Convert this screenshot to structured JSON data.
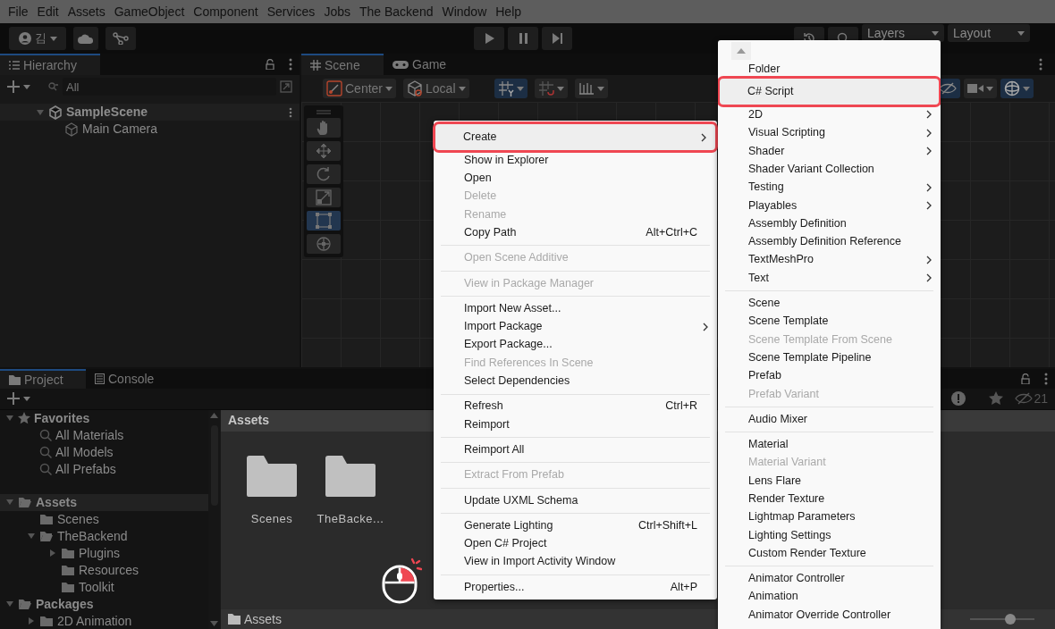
{
  "menu_bar": [
    "File",
    "Edit",
    "Assets",
    "GameObject",
    "Component",
    "Services",
    "Jobs",
    "The Backend",
    "Window",
    "Help"
  ],
  "toolbar": {
    "account": "김",
    "layers": "Layers",
    "layout": "Layout"
  },
  "hierarchy": {
    "title": "Hierarchy",
    "search_placeholder": "All",
    "scene": {
      "label": "SampleScene",
      "expanded": true
    },
    "objects": [
      {
        "label": "Main Camera"
      }
    ]
  },
  "scene_view": {
    "tabs": [
      {
        "label": "Scene",
        "selected": true
      },
      {
        "label": "Game",
        "selected": false
      }
    ],
    "pivot": "Center",
    "space": "Local",
    "tools": [
      {
        "kind": "hand",
        "selected": false
      },
      {
        "kind": "move",
        "selected": false
      },
      {
        "kind": "rotate",
        "selected": false
      },
      {
        "kind": "scale",
        "selected": false
      },
      {
        "kind": "rect",
        "selected": true
      },
      {
        "kind": "transform",
        "selected": false
      }
    ]
  },
  "project": {
    "tabs": [
      {
        "label": "Project",
        "selected": true
      },
      {
        "label": "Console",
        "selected": false
      }
    ],
    "tree": [
      {
        "label": "Favorites",
        "kind": "favorites",
        "expanded": true,
        "selected": false,
        "children": [
          {
            "label": "All Materials",
            "kind": "search",
            "selected": false
          },
          {
            "label": "All Models",
            "kind": "search",
            "selected": false
          },
          {
            "label": "All Prefabs",
            "kind": "search",
            "selected": false
          }
        ]
      },
      {
        "label": "Assets",
        "kind": "folder",
        "expanded": true,
        "selected": true,
        "children": [
          {
            "label": "Scenes",
            "kind": "folder",
            "selected": false
          },
          {
            "label": "TheBackend",
            "kind": "folder",
            "expanded": true,
            "selected": false,
            "children": [
              {
                "label": "Plugins",
                "kind": "folder",
                "expanded": false,
                "selected": false
              },
              {
                "label": "Resources",
                "kind": "folder",
                "selected": false
              },
              {
                "label": "Toolkit",
                "kind": "folder",
                "selected": false
              }
            ]
          }
        ]
      },
      {
        "label": "Packages",
        "kind": "folder",
        "expanded": true,
        "selected": false,
        "children": [
          {
            "label": "2D Animation",
            "kind": "folder",
            "expanded": false,
            "selected": false
          }
        ]
      }
    ],
    "breadcrumb": "Assets",
    "items": [
      {
        "label": "Scenes"
      },
      {
        "label": "TheBacke..."
      }
    ],
    "hidden_count": "21",
    "footer": "Assets",
    "icon_size": {
      "level": 0.62
    }
  },
  "context_menu": {
    "groups": [
      [
        {
          "label": "Create",
          "submenu": true,
          "disabled": false,
          "highlighted": true
        },
        {
          "label": "Show in Explorer",
          "disabled": false,
          "highlighted": false
        },
        {
          "label": "Open",
          "disabled": false,
          "highlighted": false
        },
        {
          "label": "Delete",
          "disabled": true,
          "highlighted": false
        },
        {
          "label": "Rename",
          "disabled": true,
          "highlighted": false
        },
        {
          "label": "Copy Path",
          "shortcut": "Alt+Ctrl+C",
          "disabled": false,
          "highlighted": false
        }
      ],
      [
        {
          "label": "Open Scene Additive",
          "disabled": true,
          "highlighted": false
        }
      ],
      [
        {
          "label": "View in Package Manager",
          "disabled": true,
          "highlighted": false
        }
      ],
      [
        {
          "label": "Import New Asset...",
          "disabled": false,
          "highlighted": false
        },
        {
          "label": "Import Package",
          "submenu": true,
          "disabled": false,
          "highlighted": false
        },
        {
          "label": "Export Package...",
          "disabled": false,
          "highlighted": false
        },
        {
          "label": "Find References In Scene",
          "disabled": true,
          "highlighted": false
        },
        {
          "label": "Select Dependencies",
          "disabled": false,
          "highlighted": false
        }
      ],
      [
        {
          "label": "Refresh",
          "shortcut": "Ctrl+R",
          "disabled": false,
          "highlighted": false
        },
        {
          "label": "Reimport",
          "disabled": false,
          "highlighted": false
        }
      ],
      [
        {
          "label": "Reimport All",
          "disabled": false,
          "highlighted": false
        }
      ],
      [
        {
          "label": "Extract From Prefab",
          "disabled": true,
          "highlighted": false
        }
      ],
      [
        {
          "label": "Update UXML Schema",
          "disabled": false,
          "highlighted": false
        }
      ],
      [
        {
          "label": "Generate Lighting",
          "shortcut": "Ctrl+Shift+L",
          "disabled": false,
          "highlighted": false
        },
        {
          "label": "Open C# Project",
          "disabled": false,
          "highlighted": false
        },
        {
          "label": "View in Import Activity Window",
          "disabled": false,
          "highlighted": false
        }
      ],
      [
        {
          "label": "Properties...",
          "shortcut": "Alt+P",
          "disabled": false,
          "highlighted": false
        }
      ]
    ]
  },
  "create_submenu": {
    "groups": [
      [
        {
          "label": "Folder",
          "disabled": false,
          "highlighted": false
        },
        {
          "label": "C# Script",
          "disabled": false,
          "highlighted": true
        },
        {
          "label": "2D",
          "submenu": true,
          "disabled": false,
          "highlighted": false
        },
        {
          "label": "Visual Scripting",
          "submenu": true,
          "disabled": false,
          "highlighted": false
        },
        {
          "label": "Shader",
          "submenu": true,
          "disabled": false,
          "highlighted": false
        },
        {
          "label": "Shader Variant Collection",
          "disabled": false,
          "highlighted": false
        },
        {
          "label": "Testing",
          "submenu": true,
          "disabled": false,
          "highlighted": false
        },
        {
          "label": "Playables",
          "submenu": true,
          "disabled": false,
          "highlighted": false
        },
        {
          "label": "Assembly Definition",
          "disabled": false,
          "highlighted": false
        },
        {
          "label": "Assembly Definition Reference",
          "disabled": false,
          "highlighted": false
        },
        {
          "label": "TextMeshPro",
          "submenu": true,
          "disabled": false,
          "highlighted": false
        },
        {
          "label": "Text",
          "submenu": true,
          "disabled": false,
          "highlighted": false
        }
      ],
      [
        {
          "label": "Scene",
          "disabled": false,
          "highlighted": false
        },
        {
          "label": "Scene Template",
          "disabled": false,
          "highlighted": false
        },
        {
          "label": "Scene Template From Scene",
          "disabled": true,
          "highlighted": false
        },
        {
          "label": "Scene Template Pipeline",
          "disabled": false,
          "highlighted": false
        },
        {
          "label": "Prefab",
          "disabled": false,
          "highlighted": false
        },
        {
          "label": "Prefab Variant",
          "disabled": true,
          "highlighted": false
        }
      ],
      [
        {
          "label": "Audio Mixer",
          "disabled": false,
          "highlighted": false
        }
      ],
      [
        {
          "label": "Material",
          "disabled": false,
          "highlighted": false
        },
        {
          "label": "Material Variant",
          "disabled": true,
          "highlighted": false
        },
        {
          "label": "Lens Flare",
          "disabled": false,
          "highlighted": false
        },
        {
          "label": "Render Texture",
          "disabled": false,
          "highlighted": false
        },
        {
          "label": "Lightmap Parameters",
          "disabled": false,
          "highlighted": false
        },
        {
          "label": "Lighting Settings",
          "disabled": false,
          "highlighted": false
        },
        {
          "label": "Custom Render Texture",
          "disabled": false,
          "highlighted": false
        }
      ],
      [
        {
          "label": "Animator Controller",
          "disabled": false,
          "highlighted": false
        },
        {
          "label": "Animation",
          "disabled": false,
          "highlighted": false
        },
        {
          "label": "Animator Override Controller",
          "disabled": false,
          "highlighted": false
        }
      ]
    ]
  }
}
